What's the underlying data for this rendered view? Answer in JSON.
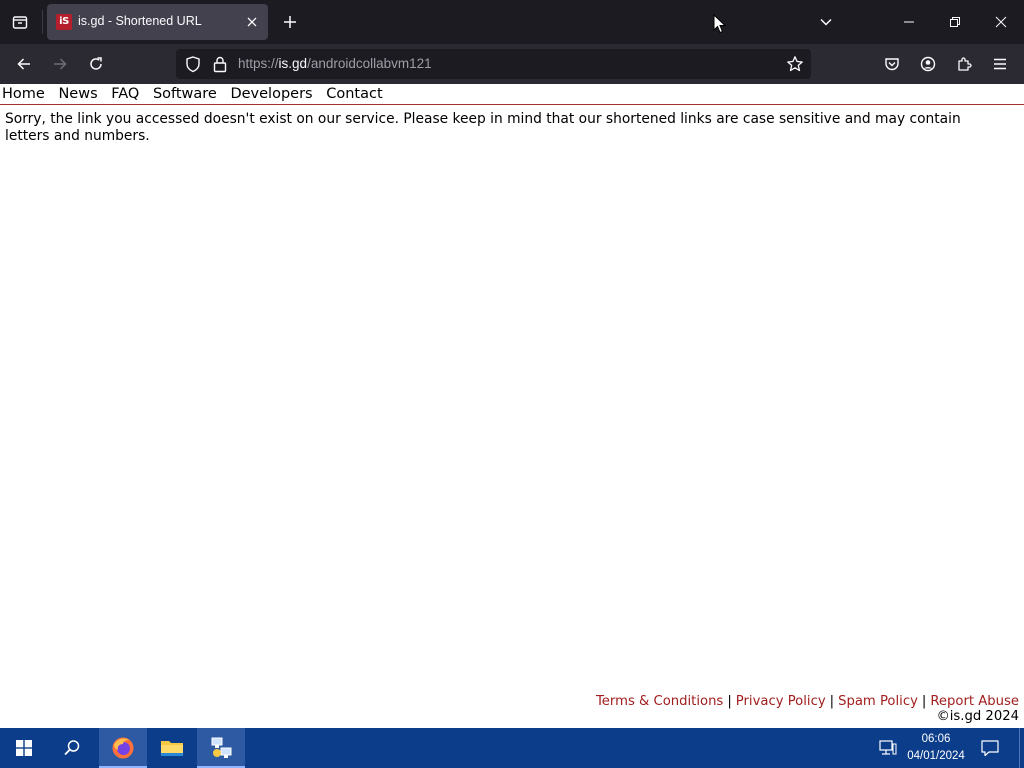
{
  "browser": {
    "tab": {
      "title": "is.gd - Shortened URL",
      "favicon_text": "iS",
      "favicon_color": "#b51f2d"
    },
    "url": {
      "scheme": "https://",
      "host": "is.gd",
      "path": "/androidcollabvm121"
    }
  },
  "site": {
    "nav": [
      "Home",
      "News",
      "FAQ",
      "Software",
      "Developers",
      "Contact"
    ],
    "message": "Sorry, the link you accessed doesn't exist on our service. Please keep in mind that our shortened links are case sensitive and may contain letters and numbers.",
    "footer": {
      "links": [
        "Terms & Conditions",
        "Privacy Policy",
        "Spam Policy",
        "Report Abuse"
      ],
      "separator": "|",
      "copyright": "©is.gd 2024"
    },
    "accent_color": "#a11e1e"
  },
  "taskbar": {
    "time": "06:06",
    "date": "04/01/2024",
    "pinned": [
      "start-icon",
      "search-icon",
      "firefox-icon",
      "file-explorer-icon",
      "network-app-icon"
    ]
  }
}
